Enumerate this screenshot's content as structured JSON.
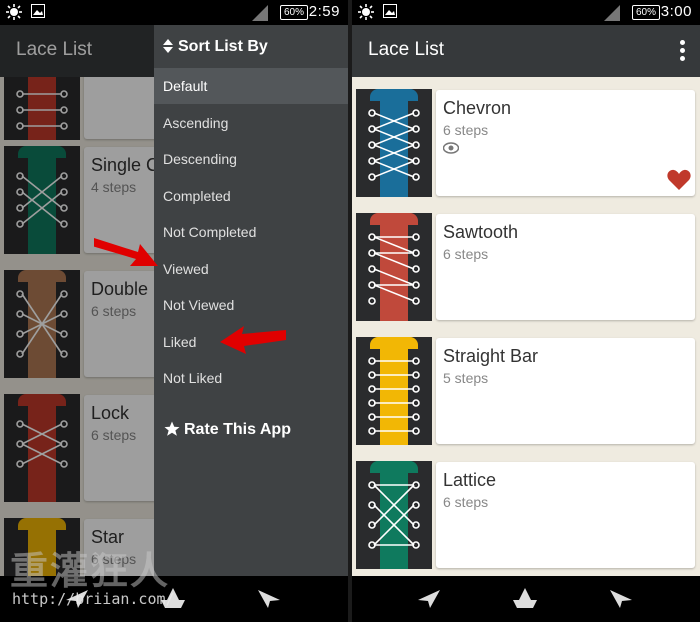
{
  "left": {
    "status": {
      "battery": "60%",
      "time": "2:59"
    },
    "app_title": "Lace List",
    "cards": [
      {
        "name": "",
        "steps": "",
        "color": "#c0392b"
      },
      {
        "name": "Single C",
        "steps": "4 steps",
        "color": "#0f7a5e"
      },
      {
        "name": "Double",
        "steps": "6 steps",
        "color": "#b07a55"
      },
      {
        "name": "Lock",
        "steps": "6 steps",
        "color": "#c0392b"
      },
      {
        "name": "Star",
        "steps": "6 steps",
        "color": "#f2b705"
      }
    ],
    "drawer": {
      "header": "Sort List By",
      "items": [
        {
          "label": "Default",
          "active": true
        },
        {
          "label": "Ascending"
        },
        {
          "label": "Descending"
        },
        {
          "label": "Completed"
        },
        {
          "label": "Not Completed"
        },
        {
          "label": "Viewed"
        },
        {
          "label": "Not Viewed"
        },
        {
          "label": "Liked"
        },
        {
          "label": "Not Liked"
        }
      ],
      "rate_label": "Rate This App"
    },
    "watermark": {
      "line1": "重灌狂人",
      "line2": "http://briian.com/"
    }
  },
  "right": {
    "status": {
      "battery": "60%",
      "time": "3:00"
    },
    "app_title": "Lace List",
    "cards": [
      {
        "name": "Chevron",
        "steps": "6 steps",
        "color": "#1a6e9a",
        "viewed": true,
        "liked": true
      },
      {
        "name": "Sawtooth",
        "steps": "6 steps",
        "color": "#c0493b"
      },
      {
        "name": "Straight Bar",
        "steps": "5 steps",
        "color": "#f2b705"
      },
      {
        "name": "Lattice",
        "steps": "6 steps",
        "color": "#0f7a5e"
      }
    ]
  },
  "colors": {
    "appbar": "#36393b",
    "drawer": "#3f4244",
    "background": "#efebe0",
    "heart": "#c0392b",
    "arrow": "#e00000"
  },
  "icons": {
    "status_left": [
      "brightness-icon",
      "image-icon"
    ],
    "status_right": [
      "signal-icon",
      "battery-icon"
    ],
    "nav": [
      "paper-plane-left-icon",
      "paper-boat-icon",
      "paper-plane-right-icon"
    ]
  }
}
